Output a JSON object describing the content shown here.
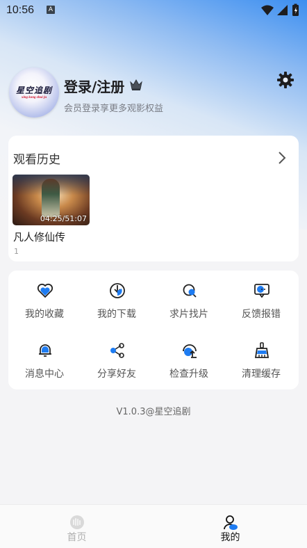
{
  "status_bar": {
    "time": "10:56",
    "indicator": "A"
  },
  "profile": {
    "avatar_title": "星空追剧",
    "avatar_subtitle": "xing kong zhui ju",
    "login_label": "登录/注册",
    "subtitle": "会员登录享更多观影权益"
  },
  "history": {
    "title": "观看历史",
    "items": [
      {
        "title": "凡人修仙传",
        "progress": "04:25/51:07",
        "episode": "1"
      }
    ]
  },
  "menu": {
    "items": [
      {
        "label": "我的收藏",
        "icon": "heart-icon"
      },
      {
        "label": "我的下载",
        "icon": "download-icon"
      },
      {
        "label": "求片找片",
        "icon": "search-icon"
      },
      {
        "label": "反馈报错",
        "icon": "feedback-icon"
      },
      {
        "label": "消息中心",
        "icon": "bell-icon"
      },
      {
        "label": "分享好友",
        "icon": "share-icon"
      },
      {
        "label": "检查升级",
        "icon": "upgrade-icon"
      },
      {
        "label": "清理缓存",
        "icon": "broom-icon"
      }
    ]
  },
  "version_text": "V1.0.3@星空追剧",
  "tabs": [
    {
      "label": "首页",
      "active": false
    },
    {
      "label": "我的",
      "active": true
    }
  ],
  "colors": {
    "accent": "#1e7cf2",
    "inactive_tab": "#b0b0b0",
    "active_tab": "#111111"
  }
}
